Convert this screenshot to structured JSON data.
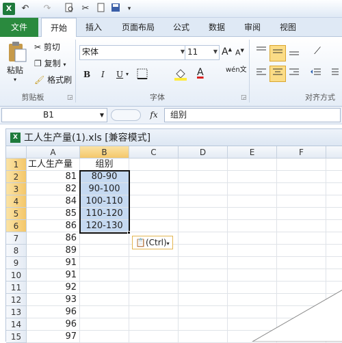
{
  "qat": {
    "undo": "↶",
    "redo": "↷"
  },
  "tabs": [
    "文件",
    "开始",
    "插入",
    "页面布局",
    "公式",
    "数据",
    "审阅",
    "视图"
  ],
  "clipboard": {
    "paste": "粘贴",
    "cut": "剪切",
    "copy": "复制",
    "format_painter": "格式刷",
    "label": "剪贴板"
  },
  "font": {
    "name": "宋体",
    "size": "11",
    "bold": "B",
    "italic": "I",
    "underline": "U",
    "phonetic": "wén文",
    "label": "字体",
    "grow": "A",
    "shrink": "A"
  },
  "alignment": {
    "label": "对齐方式"
  },
  "formula_bar": {
    "name_box": "B1",
    "fx": "fx",
    "content": "组别"
  },
  "workbook": {
    "title": "工人生产量(1).xls  [兼容模式]"
  },
  "columns": [
    "A",
    "B",
    "C",
    "D",
    "E",
    "F"
  ],
  "rows": [
    {
      "n": "1",
      "a": "工人生产量",
      "b": "组别"
    },
    {
      "n": "2",
      "a": "81",
      "b": "80-90"
    },
    {
      "n": "3",
      "a": "82",
      "b": "90-100"
    },
    {
      "n": "4",
      "a": "84",
      "b": "100-110"
    },
    {
      "n": "5",
      "a": "85",
      "b": "110-120"
    },
    {
      "n": "6",
      "a": "86",
      "b": "120-130"
    },
    {
      "n": "7",
      "a": "86",
      "b": ""
    },
    {
      "n": "8",
      "a": "89",
      "b": ""
    },
    {
      "n": "9",
      "a": "91",
      "b": ""
    },
    {
      "n": "10",
      "a": "91",
      "b": ""
    },
    {
      "n": "11",
      "a": "92",
      "b": ""
    },
    {
      "n": "12",
      "a": "93",
      "b": ""
    },
    {
      "n": "13",
      "a": "96",
      "b": ""
    },
    {
      "n": "14",
      "a": "96",
      "b": ""
    },
    {
      "n": "15",
      "a": "97",
      "b": ""
    }
  ],
  "paste_options": {
    "label": "(Ctrl)"
  },
  "colors": {
    "selection_fill": "#c5d9f1",
    "header_selected": "#f4c76a",
    "file_tab": "#2a8a3e"
  }
}
